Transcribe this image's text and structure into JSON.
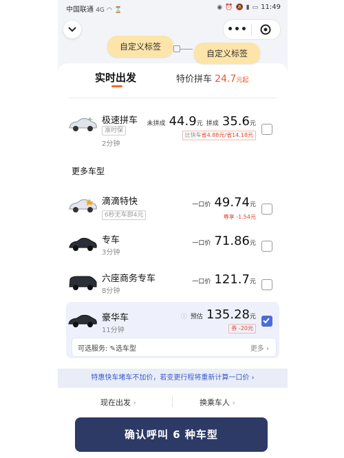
{
  "status_bar": {
    "carrier": "中国联通",
    "network": "4G",
    "time": "11:49"
  },
  "header": {
    "more_icon": "more-dots-icon",
    "target_icon": "target-icon"
  },
  "tags": {
    "tag1": "自定义标签",
    "tag2": "自定义标签"
  },
  "tabs": [
    {
      "label": "实时出发",
      "active": true
    },
    {
      "label": "特价拼车",
      "price": "24.7",
      "unit": "元起"
    }
  ],
  "rows": {
    "express_pool": {
      "name": "极速拼车",
      "badge": "准时保",
      "eta": "2分钟",
      "unpooled_label": "未拼成",
      "unpooled_price": "44.9",
      "pooled_label": "拼成",
      "pooled_price": "35.6",
      "unit": "元",
      "savings_prefix": "比快车",
      "savings": "省4.88元/省14.18元",
      "checked": false
    },
    "more_title": "更多车型",
    "dd_express": {
      "name": "滴滴特快",
      "badge": "6秒无车即4元",
      "price_label": "一口价",
      "price": "49.74",
      "unit": "元",
      "sub": "尊享 -1.54元",
      "checked": false
    },
    "premier": {
      "name": "专车",
      "eta": "3分钟",
      "price_label": "一口价",
      "price": "71.86",
      "unit": "元",
      "checked": false
    },
    "six_seat": {
      "name": "六座商务专车",
      "eta": "8分钟",
      "price_label": "一口价",
      "price": "121.7",
      "unit": "元",
      "checked": false
    },
    "luxury": {
      "name": "豪华车",
      "eta": "11分钟",
      "price_label": "预估",
      "price": "135.28",
      "unit": "元",
      "sub": "券 -20元",
      "checked": true
    }
  },
  "service": {
    "label": "可选服务: ",
    "value": "选车型",
    "more": "更多"
  },
  "notice": "特惠快车堵车不加价，若变更行程将重新计算一口价",
  "options": {
    "now": "现在出发",
    "passenger": "换乘车人"
  },
  "confirm": "确认呼叫 6 种车型",
  "colors": {
    "accent": "#f26b2a",
    "price_red": "#f0532d",
    "confirm_bg": "#2d3a66",
    "check_blue": "#4d6bd8"
  }
}
